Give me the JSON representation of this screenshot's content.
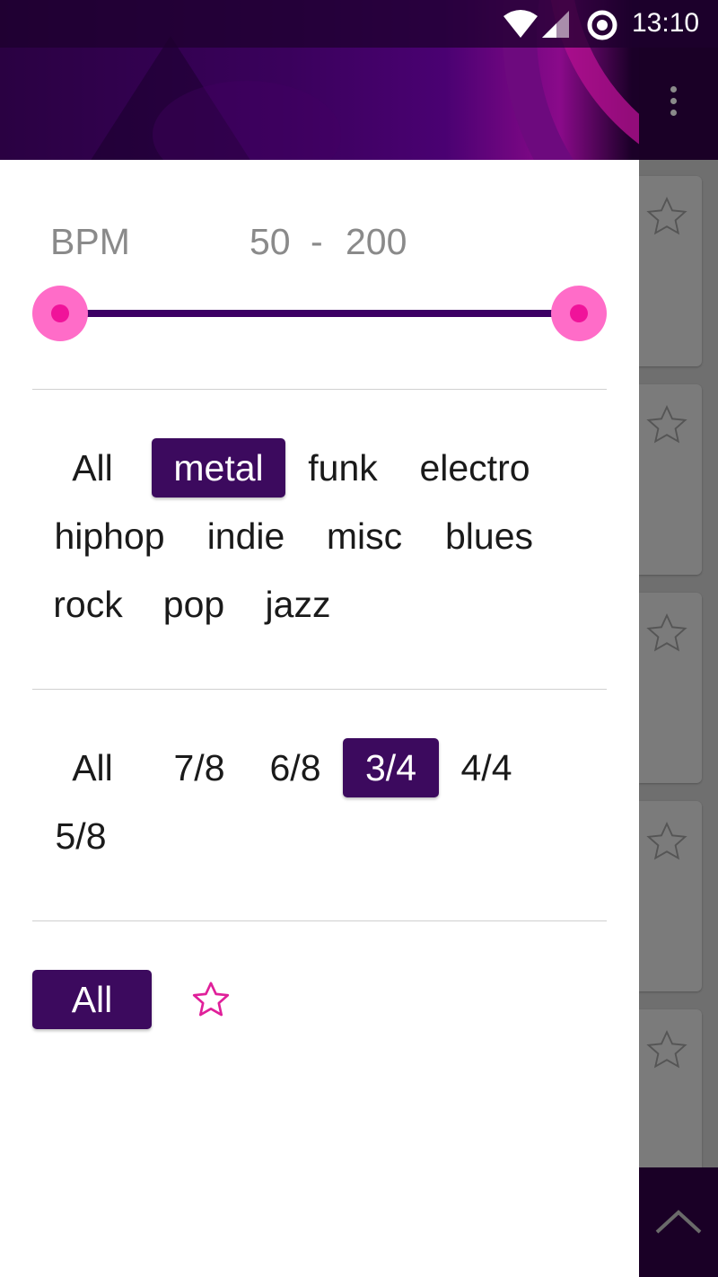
{
  "status_bar": {
    "time": "13:10",
    "icons": [
      "wifi-icon",
      "signal-icon",
      "sync-icon"
    ]
  },
  "toolbar": {
    "overflow_icon": "more-vert-icon"
  },
  "background_list": {
    "card_icon": "star-outline-icon",
    "card_count": 5,
    "scroll_up_icon": "chevron-up-icon"
  },
  "filters": {
    "bpm": {
      "label": "BPM",
      "min": "50",
      "separator": "-",
      "max": "200"
    },
    "genres": {
      "options": [
        "All",
        "metal",
        "funk",
        "electro",
        "hiphop",
        "indie",
        "misc",
        "blues",
        "rock",
        "pop",
        "jazz"
      ],
      "selected": "metal"
    },
    "time_signatures": {
      "options": [
        "All",
        "7/8",
        "6/8",
        "3/4",
        "4/4",
        "5/8"
      ],
      "selected": "3/4"
    },
    "favorites": {
      "all_label": "All",
      "selected": "All",
      "star_icon": "star-outline-icon"
    }
  },
  "colors": {
    "accent": "#3c0a5e",
    "slider_thumb": "#ff6cc8",
    "slider_thumb_center": "#f0139a",
    "star_pink": "#e0209a",
    "header_purple": "#3a015c"
  }
}
